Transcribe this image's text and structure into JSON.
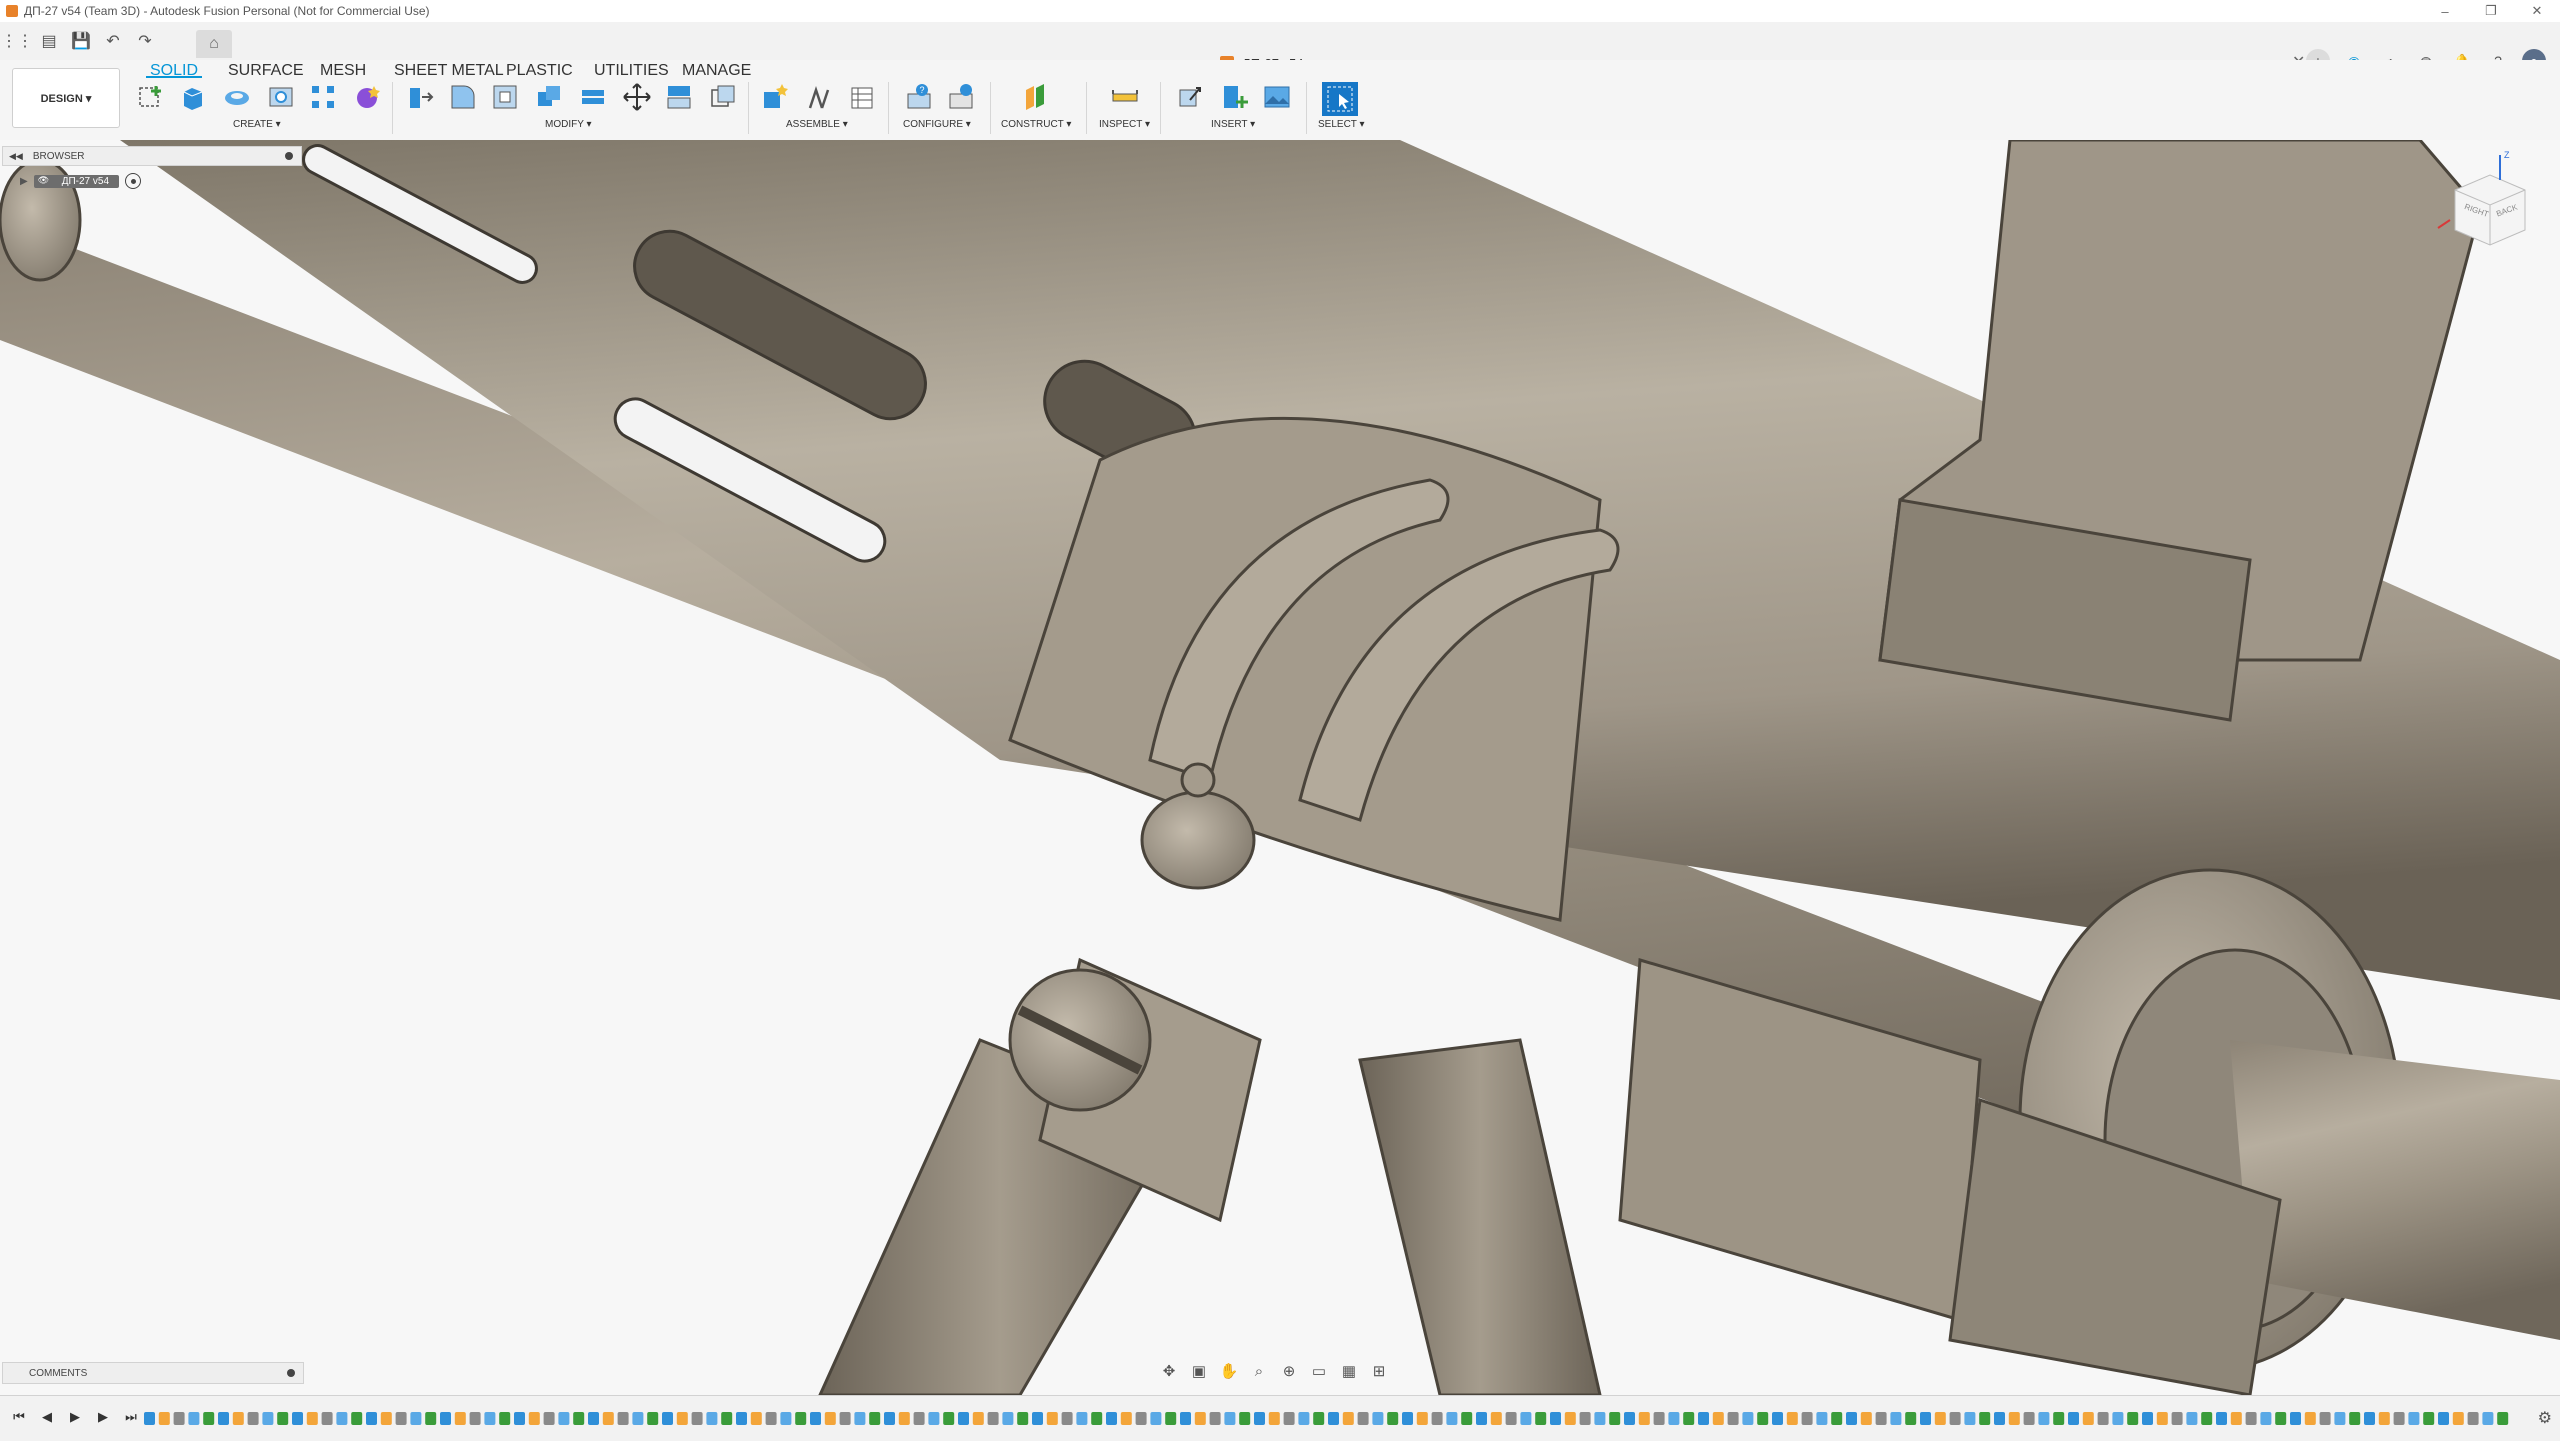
{
  "window": {
    "title": "ДП-27 v54 (Team 3D) - Autodesk Fusion Personal (Not for Commercial Use)",
    "controls": [
      "minimize-icon",
      "restore-icon",
      "close-icon"
    ]
  },
  "quick_access": {
    "icons": [
      "grid-menu-icon",
      "file-icon",
      "save-icon",
      "undo-icon",
      "redo-icon"
    ],
    "home_icon": "home-icon"
  },
  "document_tab": {
    "label": "ДП-27 v54",
    "close_icon": "close-icon"
  },
  "header_right_icons": [
    "add-tab-icon",
    "extensions-icon",
    "job-status-icon",
    "online-icon",
    "notifications-icon",
    "help-icon",
    "user-avatar-icon"
  ],
  "workspace": {
    "label": "DESIGN ▾"
  },
  "toolbar": {
    "tabs": [
      {
        "label": "SOLID",
        "active": true
      },
      {
        "label": "SURFACE",
        "active": false
      },
      {
        "label": "MESH",
        "active": false
      },
      {
        "label": "SHEET METAL",
        "active": false
      },
      {
        "label": "PLASTIC",
        "active": false
      },
      {
        "label": "UTILITIES",
        "active": false
      },
      {
        "label": "MANAGE",
        "active": false
      }
    ],
    "groups": [
      {
        "label": "CREATE ▾"
      },
      {
        "label": "MODIFY ▾"
      },
      {
        "label": "ASSEMBLE ▾"
      },
      {
        "label": "CONFIGURE ▾"
      },
      {
        "label": "CONSTRUCT ▾"
      },
      {
        "label": "INSPECT ▾"
      },
      {
        "label": "INSERT ▾"
      },
      {
        "label": "SELECT ▾"
      }
    ]
  },
  "browser": {
    "title": "BROWSER",
    "root_node": "ДП-27 v54"
  },
  "viewcube": {
    "faces": [
      "RIGHT",
      "BACK"
    ],
    "axis_label": "Z"
  },
  "comments": {
    "title": "COMMENTS"
  },
  "navbar_icons": [
    "orbit-icon",
    "look-at-icon",
    "pan-icon",
    "zoom-icon",
    "fit-icon",
    "display-settings-icon",
    "grid-icon",
    "viewports-icon"
  ],
  "timeline": {
    "controls": [
      "go-to-start-icon",
      "step-back-icon",
      "play-icon",
      "step-forward-icon",
      "go-to-end-icon"
    ],
    "settings_icon": "gear-icon"
  },
  "colors": {
    "accent": "#0696d7",
    "part_metal": "#9c9385",
    "background": "#f7f7f7"
  }
}
